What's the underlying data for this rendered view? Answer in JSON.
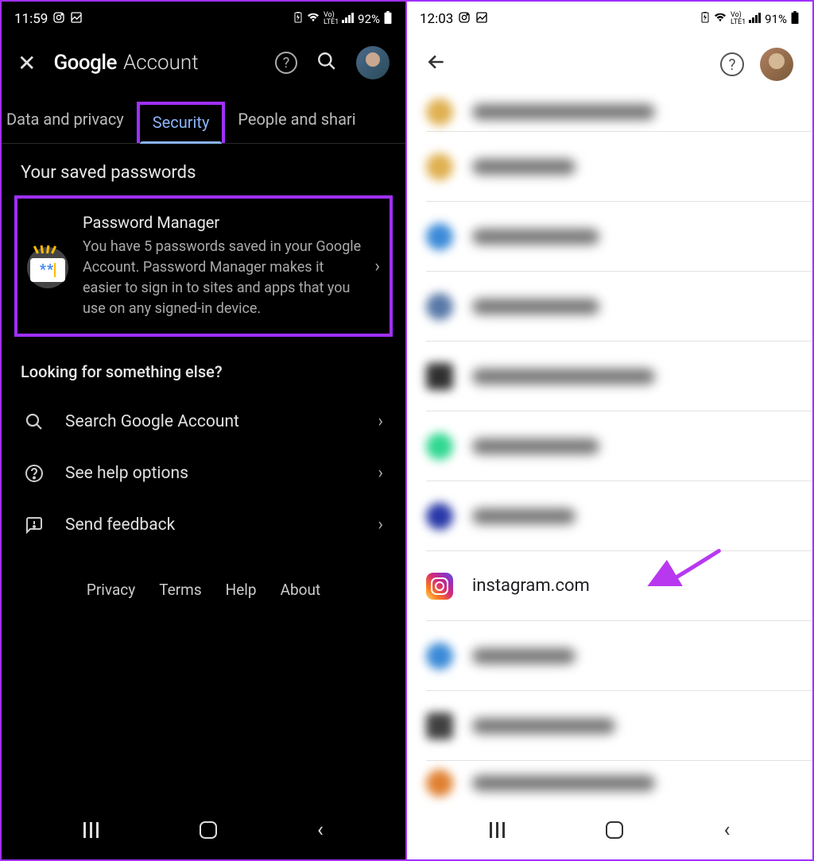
{
  "left": {
    "status": {
      "time": "11:59",
      "battery": "92%"
    },
    "header": {
      "google": "Google",
      "account": "Account"
    },
    "tabs": {
      "data_privacy": "Data and privacy",
      "security": "Security",
      "people": "People and shari"
    },
    "saved_section_title": "Your saved passwords",
    "pw_card": {
      "title": "Password Manager",
      "desc": "You have 5 passwords saved in your Google Account. Password Manager makes it easier to sign in to sites and apps that you use on any signed-in device."
    },
    "looking_title": "Looking for something else?",
    "options": {
      "search": "Search Google Account",
      "help": "See help options",
      "feedback": "Send feedback"
    },
    "footer": {
      "privacy": "Privacy",
      "terms": "Terms",
      "help": "Help",
      "about": "About"
    }
  },
  "right": {
    "status": {
      "time": "12:03",
      "battery": "91%"
    },
    "instagram_label": "instagram.com",
    "blur_colors": [
      "#e0b050",
      "#e0b050",
      "#3a8ad8",
      "#5878a8",
      "#303030",
      "#30d890",
      "#2838a8",
      null,
      "#3a8ad8",
      "#404040",
      "#e08030"
    ]
  },
  "highlight_color": "#a030ff"
}
